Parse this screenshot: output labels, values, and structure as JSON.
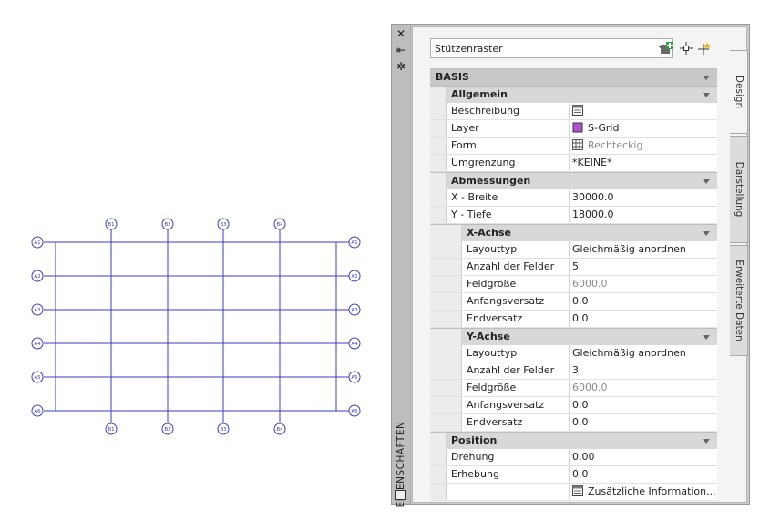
{
  "drawing": {
    "grid_color": "#3b3bc4",
    "bubbles_top": [
      "B1",
      "B2",
      "B3",
      "B4"
    ],
    "bubbles_bottom": [
      "B1",
      "B2",
      "B3",
      "B4"
    ],
    "bubbles_left": [
      "A1",
      "A2",
      "A3",
      "A4",
      "A5",
      "A6"
    ],
    "bubbles_right": [
      "A1",
      "A2",
      "A3",
      "A4",
      "A5",
      "A6"
    ]
  },
  "palette": {
    "title": "EIGENSCHAFTEN",
    "object_select": "Stützenraster",
    "tabs": [
      "Design",
      "Darstellung",
      "Erweiterte Daten"
    ],
    "rows": [
      {
        "type": "header",
        "level": 0,
        "label": "BASIS",
        "top": true
      },
      {
        "type": "header",
        "level": 1,
        "label": "Allgemein"
      },
      {
        "type": "prop",
        "level": 1,
        "label": "Beschreibung",
        "value": "",
        "icon": "description-icon"
      },
      {
        "type": "prop",
        "level": 1,
        "label": "Layer",
        "value": "S-Grid",
        "icon": "layer-color-swatch",
        "swatch": "#b34fd6"
      },
      {
        "type": "prop",
        "level": 1,
        "label": "Form",
        "value": "Rechteckig",
        "icon": "grid-shape-icon",
        "muted": true
      },
      {
        "type": "prop",
        "level": 1,
        "label": "Umgrenzung",
        "value": "*KEINE*"
      },
      {
        "type": "header",
        "level": 1,
        "label": "Abmessungen"
      },
      {
        "type": "prop",
        "level": 1,
        "label": "X - Breite",
        "value": "30000.0"
      },
      {
        "type": "prop",
        "level": 1,
        "label": "Y - Tiefe",
        "value": "18000.0"
      },
      {
        "type": "header",
        "level": 2,
        "label": "X-Achse"
      },
      {
        "type": "prop",
        "level": 2,
        "label": "Layouttyp",
        "value": "Gleichmäßig anordnen"
      },
      {
        "type": "prop",
        "level": 2,
        "label": "Anzahl der Felder",
        "value": "5"
      },
      {
        "type": "prop",
        "level": 2,
        "label": "Feldgröße",
        "value": "6000.0",
        "muted": true
      },
      {
        "type": "prop",
        "level": 2,
        "label": "Anfangsversatz",
        "value": "0.0"
      },
      {
        "type": "prop",
        "level": 2,
        "label": "Endversatz",
        "value": "0.0"
      },
      {
        "type": "header",
        "level": 2,
        "label": "Y-Achse"
      },
      {
        "type": "prop",
        "level": 2,
        "label": "Layouttyp",
        "value": "Gleichmäßig anordnen"
      },
      {
        "type": "prop",
        "level": 2,
        "label": "Anzahl der Felder",
        "value": "3"
      },
      {
        "type": "prop",
        "level": 2,
        "label": "Feldgröße",
        "value": "6000.0",
        "muted": true
      },
      {
        "type": "prop",
        "level": 2,
        "label": "Anfangsversatz",
        "value": "0.0"
      },
      {
        "type": "prop",
        "level": 2,
        "label": "Endversatz",
        "value": "0.0"
      },
      {
        "type": "header",
        "level": 1,
        "label": "Position"
      },
      {
        "type": "prop",
        "level": 1,
        "label": "Drehung",
        "value": "0.00"
      },
      {
        "type": "prop",
        "level": 1,
        "label": "Erhebung",
        "value": "0.0"
      },
      {
        "type": "prop",
        "level": 1,
        "label": "",
        "value": "Zusätzliche  Information...",
        "icon": "info-table-icon"
      }
    ]
  }
}
